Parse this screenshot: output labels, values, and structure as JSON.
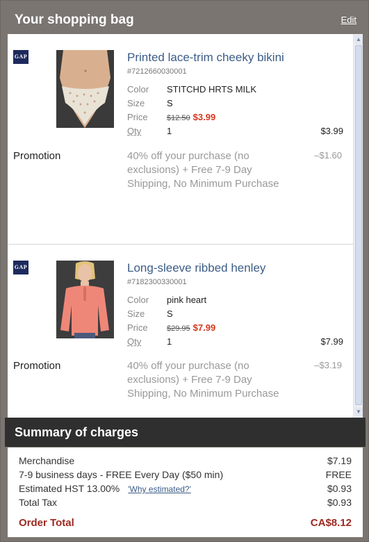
{
  "header": {
    "title": "Your shopping bag",
    "edit_label": "Edit"
  },
  "items": [
    {
      "brand": "GAP",
      "name": "Printed lace-trim cheeky bikini",
      "sku": "#7212660030001",
      "color_label": "Color",
      "color": "STITCHD HRTS MILK",
      "size_label": "Size",
      "size": "S",
      "price_label": "Price",
      "price_old": "$12.50",
      "price_new": "$3.99",
      "qty_label": "Qty",
      "qty": "1",
      "line_total": "$3.99",
      "promo_label": "Promotion",
      "promo_text": "40% off your purchase (no exclusions) + Free 7-9 Day Shipping, No Minimum Purchase",
      "promo_amount": "–$1.60"
    },
    {
      "brand": "GAP",
      "name": "Long-sleeve ribbed henley",
      "sku": "#7182300330001",
      "color_label": "Color",
      "color": "pink heart",
      "size_label": "Size",
      "size": "S",
      "price_label": "Price",
      "price_old": "$29.95",
      "price_new": "$7.99",
      "qty_label": "Qty",
      "qty": "1",
      "line_total": "$7.99",
      "promo_label": "Promotion",
      "promo_text": "40% off your purchase (no exclusions) + Free 7-9 Day Shipping, No Minimum Purchase",
      "promo_amount": "–$3.19"
    }
  ],
  "summary": {
    "title": "Summary of charges",
    "merchandise_label": "Merchandise",
    "merchandise": "$7.19",
    "shipping_label": "7-9 business days - FREE Every Day ($50 min)",
    "shipping": "FREE",
    "hst_label": "Estimated HST 13.00%",
    "hst_link": "'Why estimated?'",
    "hst": "$0.93",
    "tax_label": "Total Tax",
    "tax": "$0.93",
    "total_label": "Order Total",
    "total": "CA$8.12"
  },
  "colors": {
    "header_bg": "#7a7571",
    "summary_bg": "#2f2f2f",
    "link": "#3b5c86",
    "sale": "#d5361b",
    "total": "#9b2a20"
  }
}
